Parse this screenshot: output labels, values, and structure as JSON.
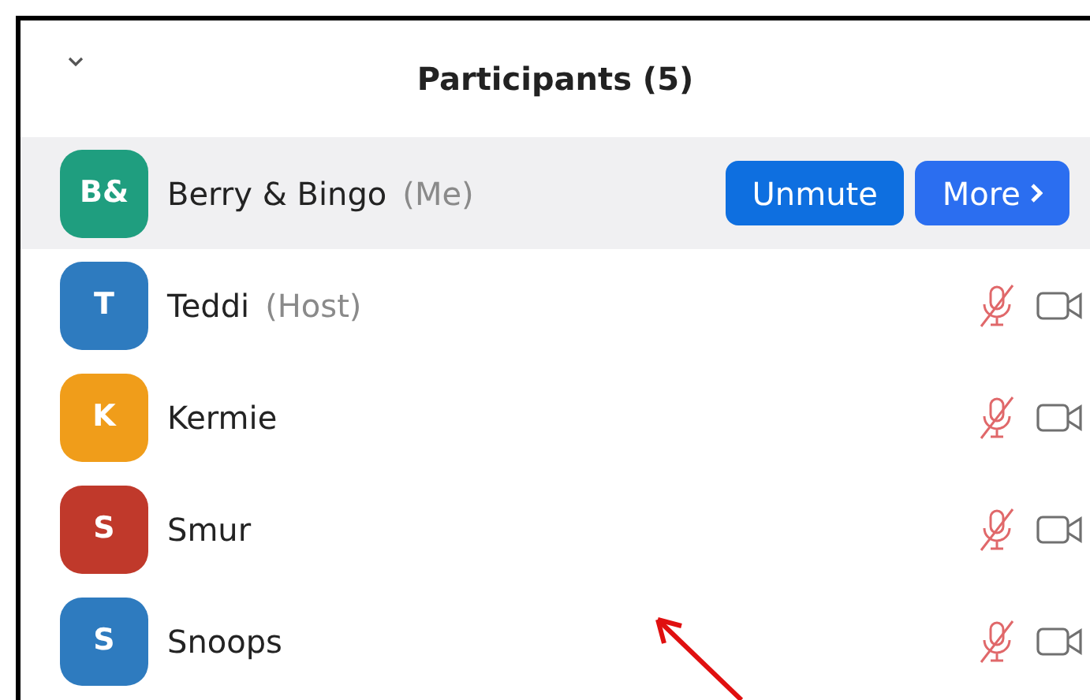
{
  "panel": {
    "title": "Participants (5)"
  },
  "participants": [
    {
      "kind": "self",
      "initials": "B&",
      "name": "Berry & Bingo",
      "role": "(Me)",
      "color": "#1f9e7f",
      "selected": true,
      "buttons": [
        "Unmute",
        "More"
      ]
    },
    {
      "kind": "other",
      "initials": "T",
      "name": "Teddi",
      "role": "(Host)",
      "color": "#2e7bbf",
      "selected": false
    },
    {
      "kind": "other",
      "initials": "K",
      "name": "Kermie",
      "color": "#f09d1a",
      "selected": false
    },
    {
      "kind": "other",
      "initials": "S",
      "name": "Smur",
      "color": "#c0392b",
      "selected": false
    },
    {
      "kind": "other",
      "initials": "S",
      "name": "Snoops",
      "color": "#2e7bbf",
      "selected": false
    }
  ]
}
